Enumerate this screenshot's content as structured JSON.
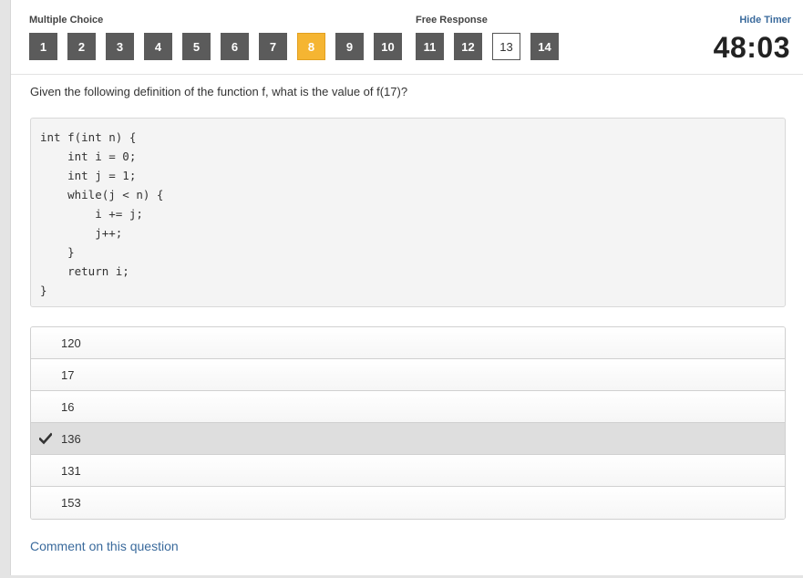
{
  "nav": {
    "multiple_choice_label": "Multiple Choice",
    "free_response_label": "Free Response",
    "questions": [
      "1",
      "2",
      "3",
      "4",
      "5",
      "6",
      "7",
      "8",
      "9",
      "10",
      "11",
      "12",
      "13",
      "14"
    ],
    "active_index": 7,
    "unanswered_index": 12
  },
  "timer": {
    "hide_label": "Hide Timer",
    "value": "48:03"
  },
  "question": {
    "prompt": "Given the following definition of the function f, what is the value of f(17)?",
    "code": "int f(int n) {\n    int i = 0;\n    int j = 1;\n    while(j < n) {\n        i += j;\n        j++;\n    }\n    return i;\n}"
  },
  "choices": {
    "items": [
      "120",
      "17",
      "16",
      "136",
      "131",
      "153"
    ],
    "selected_index": 3,
    "check_icon": "checkmark-icon"
  },
  "footer": {
    "comment_label": "Comment on this question"
  },
  "colors": {
    "active": "#f5b532",
    "nav_button": "#5b5b5b",
    "link": "#3a6a9c"
  }
}
